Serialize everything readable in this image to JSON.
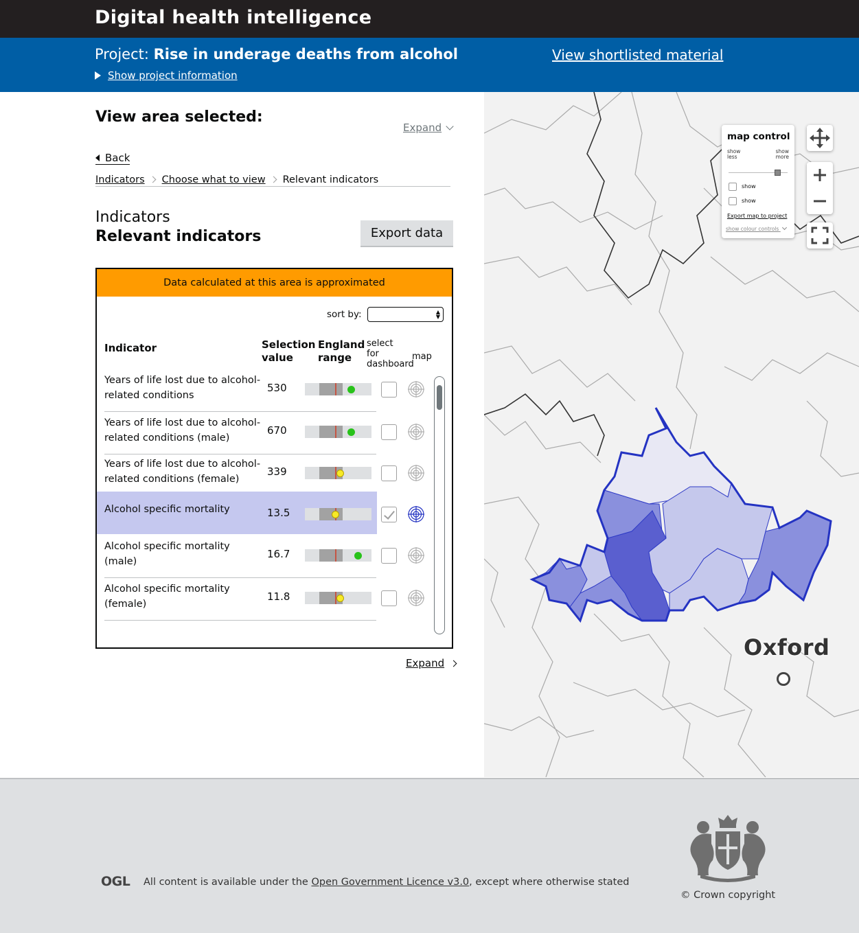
{
  "header": {
    "title": "Digital health intelligence"
  },
  "project": {
    "prefix": "Project:",
    "name": "Rise in underage deaths from alcohol",
    "show_info": "Show project information",
    "shortlisted_link": "View shortlisted material"
  },
  "left_panel": {
    "heading": "View area selected:",
    "expand_top": "Expand",
    "back": "Back",
    "breadcrumbs": [
      "Indicators",
      "Choose what to view",
      "Relevant indicators"
    ],
    "section_title": "Indicators",
    "section_subtitle": "Relevant indicators",
    "export_button": "Export data",
    "warning": "Data calculated at this area is approximated",
    "sort_label": "sort by:",
    "sort_value": "",
    "columns": {
      "indicator": "Indicator",
      "selection_value_1": "Selection",
      "selection_value_2": "value",
      "england_range_1": "England",
      "england_range_2": "range",
      "select_1": "select",
      "select_2": "for",
      "select_3": "dashboard",
      "map": "map"
    },
    "rows": [
      {
        "name": "Years of life lost due to alcohol-related conditions",
        "value": "530",
        "dot_color": "green",
        "dot_pos": 0.7,
        "selected": false
      },
      {
        "name": "Years of life lost due to alcohol-related conditions (male)",
        "value": "670",
        "dot_color": "green",
        "dot_pos": 0.7,
        "selected": false
      },
      {
        "name": "Years of life lost due to alcohol-related conditions (female)",
        "value": "339",
        "dot_color": "yellow",
        "dot_pos": 0.53,
        "selected": false
      },
      {
        "name": "Alcohol specific mortality",
        "value": "13.5",
        "dot_color": "yellow",
        "dot_pos": 0.46,
        "selected": true
      },
      {
        "name": "Alcohol specific mortality (male)",
        "value": "16.7",
        "dot_color": "green",
        "dot_pos": 0.8,
        "selected": false
      },
      {
        "name": "Alcohol specific mortality (female)",
        "value": "11.8",
        "dot_color": "yellow",
        "dot_pos": 0.53,
        "selected": false
      }
    ],
    "expand_bottom": "Expand"
  },
  "map": {
    "control_title": "map control",
    "show_less": "show less",
    "show_more": "show more",
    "checkbox_1": "show",
    "checkbox_2": "show",
    "export_link": "Export map to project",
    "colour_controls": "show colour controls",
    "place_label": "Oxford",
    "region_colors": [
      "#e8e8f4",
      "#c5c8ec",
      "#8a90dd",
      "#5a5fcf",
      "#3a3fb8"
    ]
  },
  "footer": {
    "ogl": "OGL",
    "licence_prefix": "All content is available under the ",
    "licence_link": "Open Government Licence v3.0",
    "licence_suffix": ", except where otherwise stated",
    "copyright": "© Crown copyright"
  }
}
